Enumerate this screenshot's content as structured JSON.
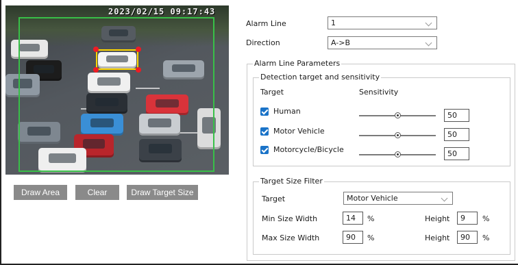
{
  "video": {
    "timestamp": "2023/02/15 09:17:43"
  },
  "buttons": {
    "draw_area": "Draw Area",
    "clear": "Clear",
    "draw_target_size": "Draw Target Size"
  },
  "alarm_line": {
    "label": "Alarm Line",
    "value": "1"
  },
  "direction": {
    "label": "Direction",
    "value": "A->B"
  },
  "params": {
    "legend": "Alarm Line Parameters",
    "detection": {
      "legend": "Detection target and sensitivity",
      "col_target": "Target",
      "col_sensitivity": "Sensitivity",
      "rows": [
        {
          "label": "Human",
          "checked": true,
          "sensitivity": "50"
        },
        {
          "label": "Motor Vehicle",
          "checked": true,
          "sensitivity": "50"
        },
        {
          "label": "Motorcycle/Bicycle",
          "checked": true,
          "sensitivity": "50"
        }
      ]
    },
    "size_filter": {
      "legend": "Target Size Filter",
      "target_label": "Target",
      "target_value": "Motor Vehicle",
      "min_label": "Min Size Width",
      "min_width": "14",
      "min_height": "9",
      "max_label": "Max Size Width",
      "max_width": "90",
      "max_height": "90",
      "height_label": "Height",
      "percent": "%"
    }
  },
  "colors": {
    "detection_area": "#38c048",
    "target_box": "#ffd800",
    "handle": "#ee1c24",
    "button_bg": "#8a8a8a",
    "checkbox": "#1a73c8"
  }
}
